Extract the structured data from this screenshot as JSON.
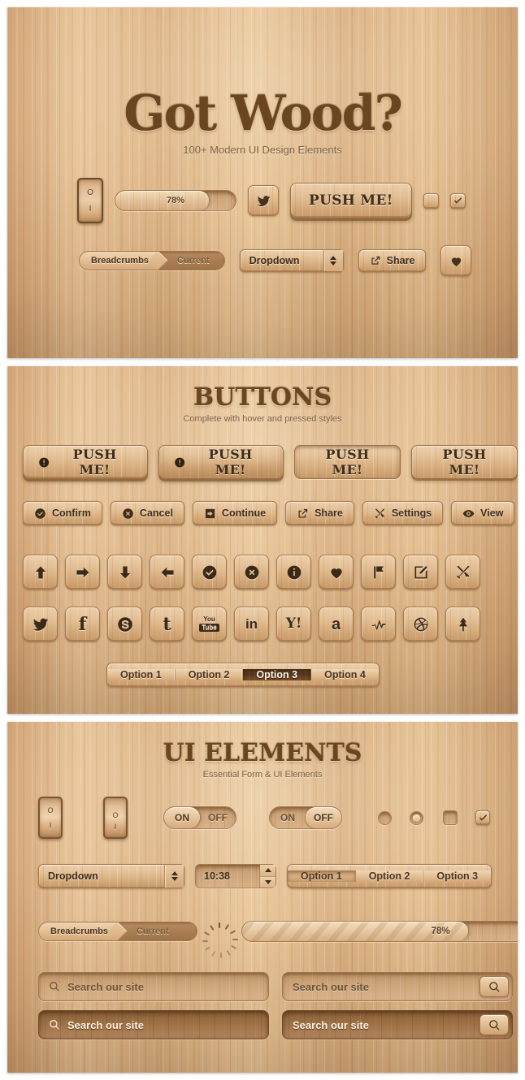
{
  "hero": {
    "title": "Got Wood?",
    "subtitle": "100+ Modern UI Design Elements",
    "rocker": {
      "top_glyph": "O",
      "bottom_glyph": "I"
    },
    "progress": {
      "value": "78%",
      "percent": 78
    },
    "bird_button": "twitter-bird",
    "push_label": "PUSH ME!",
    "breadcrumb": {
      "root": "Breadcrumbs",
      "current": "Current"
    },
    "dropdown": {
      "value": "Dropdown"
    },
    "share": {
      "label": "Share"
    }
  },
  "buttons": {
    "title": "BUTTONS",
    "subtitle": "Complete with hover and pressed styles",
    "push_buttons": [
      {
        "label": "PUSH ME!",
        "icon": "alert-icon",
        "state": "normal"
      },
      {
        "label": "PUSH ME!",
        "icon": "alert-icon",
        "state": "hover"
      },
      {
        "label": "PUSH ME!",
        "icon": "",
        "state": "pressed"
      },
      {
        "label": "PUSH ME!",
        "icon": "",
        "state": "flat"
      }
    ],
    "action_buttons": [
      {
        "label": "Confirm",
        "icon": "check-circle-icon"
      },
      {
        "label": "Cancel",
        "icon": "x-circle-icon"
      },
      {
        "label": "Continue",
        "icon": "arrow-right-box-icon"
      },
      {
        "label": "Share",
        "icon": "share-icon"
      },
      {
        "label": "Settings",
        "icon": "tools-icon"
      },
      {
        "label": "View",
        "icon": "eye-icon"
      }
    ],
    "icon_row_1": [
      "arrow-up-icon",
      "arrow-right-icon",
      "arrow-down-icon",
      "arrow-left-icon",
      "check-circle-icon",
      "x-circle-icon",
      "info-icon",
      "heart-icon",
      "flag-icon",
      "edit-icon",
      "tools-icon"
    ],
    "icon_row_2": [
      "twitter-icon",
      "facebook-icon",
      "skype-icon",
      "tumblr-icon",
      "youtube-icon",
      "linkedin-icon",
      "yahoo-icon",
      "amazon-icon",
      "appnet-icon",
      "dribbble-icon",
      "forrst-icon"
    ],
    "social_labels": {
      "facebook": "f",
      "skype": "S",
      "tumblr": "t",
      "youtube_top": "You",
      "youtube_bottom": "Tube",
      "linkedin": "in",
      "yahoo": "Y!",
      "amazon": "a"
    },
    "tabs": [
      {
        "label": "Option 1",
        "active": false
      },
      {
        "label": "Option 2",
        "active": false
      },
      {
        "label": "Option 3",
        "active": true
      },
      {
        "label": "Option 4",
        "active": false
      }
    ]
  },
  "elements": {
    "title": "UI ELEMENTS",
    "subtitle": "Essential Form & UI Elements",
    "rockers": [
      {
        "top_glyph": "O",
        "bottom_glyph": "I",
        "state": "off"
      },
      {
        "top_glyph": "O",
        "bottom_glyph": "I",
        "state": "on"
      }
    ],
    "toggles": [
      {
        "on_label": "ON",
        "off_label": "OFF",
        "selected": "ON"
      },
      {
        "on_label": "ON",
        "off_label": "OFF",
        "selected": "OFF"
      }
    ],
    "radios": [
      {
        "name": "radio-unchecked",
        "checked": false
      },
      {
        "name": "radio-checked",
        "checked": true
      }
    ],
    "checkboxes": [
      {
        "name": "checkbox-unchecked",
        "checked": false
      },
      {
        "name": "checkbox-checked",
        "checked": true
      }
    ],
    "dropdown": {
      "value": "Dropdown"
    },
    "stepper": {
      "value": "10:38"
    },
    "segmented": [
      {
        "label": "Option 1",
        "active": true
      },
      {
        "label": "Option 2",
        "active": false
      },
      {
        "label": "Option 3",
        "active": false
      }
    ],
    "breadcrumb": {
      "root": "Breadcrumbs",
      "current": "Current"
    },
    "spinner": "loading-spinner-icon",
    "progress": {
      "value": "78%",
      "percent": 78
    },
    "search_fields": [
      {
        "placeholder": "Search our site",
        "style": "light",
        "has_button": false
      },
      {
        "placeholder": "Search our site",
        "style": "light",
        "has_button": true
      },
      {
        "placeholder": "Search our site",
        "style": "dark",
        "has_button": false
      },
      {
        "placeholder": "Search our site",
        "style": "dark",
        "has_button": true
      }
    ]
  },
  "colors": {
    "wood_light": "#e6c093",
    "wood_mid": "#d4a978",
    "wood_dark": "#b98a5a",
    "title_brown": "#6b4620",
    "ink": "#4a3321",
    "active_tab": "#55341a"
  }
}
